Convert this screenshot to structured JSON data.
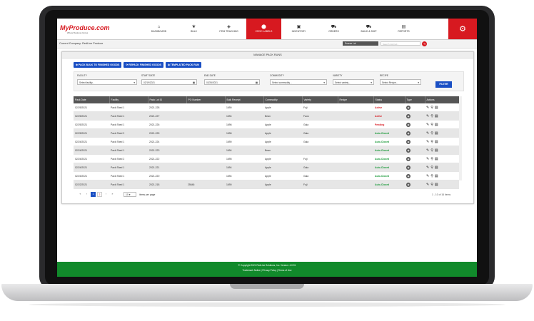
{
  "app": {
    "logo": "MyProduce.com",
    "logo_tagline": "Where Business Grows"
  },
  "nav": [
    {
      "label": "DASHBOARD",
      "icon": "home-icon",
      "glyph": "⌂"
    },
    {
      "label": "BULK",
      "icon": "leaf-icon",
      "glyph": "❦"
    },
    {
      "label": "ITEM TRACKING",
      "icon": "tag-icon",
      "glyph": "◈"
    },
    {
      "label": "CROC LABELS",
      "icon": "label-icon",
      "glyph": "⬤",
      "active": true
    },
    {
      "label": "INVENTORY",
      "icon": "box-icon",
      "glyph": "▣"
    },
    {
      "label": "ORDERS",
      "icon": "cart-icon",
      "glyph": "⛟"
    },
    {
      "label": "BUILD & SHIP",
      "icon": "truck-icon",
      "glyph": "⛟"
    },
    {
      "label": "REPORTS",
      "icon": "chart-icon",
      "glyph": "▤"
    }
  ],
  "companybar": {
    "company": "Current Company: RedLine Produce",
    "source_lot": "Source Lot",
    "search_placeholder": "Search lot/prod..."
  },
  "panel": {
    "title": "MANAGE PACK RUNS",
    "buttons": [
      "PACK BULK TO FINISHED GOODS",
      "REPACK FINISHED GOODS",
      "TEMPLATED PACK RUN"
    ]
  },
  "filters": {
    "facility_label": "FACILITY",
    "facility_value": "Select facility...",
    "start_label": "START DATE",
    "start_value": "02/19/2021",
    "end_label": "END DATE",
    "end_value": "02/26/2021",
    "commodity_label": "COMMODITY",
    "commodity_value": "Select commodity...",
    "variety_label": "VARIETY",
    "variety_value": "Select variety...",
    "recipe_label": "RECIPE",
    "recipe_value": "Select Recipe...",
    "filter_button": "FILTER"
  },
  "table": {
    "columns": [
      "Pack Date",
      "Facility",
      "Pack Lot ID",
      "PO Number",
      "Bulk Receipt",
      "Commodity",
      "Variety",
      "Recipe",
      "Status",
      "Type",
      "Actions"
    ],
    "rows": [
      {
        "date": "02/25/2021",
        "facility": "Pack Shed 1",
        "lot": "2021-228",
        "po": "",
        "receipt": "1690",
        "commodity": "Apple",
        "variety": "Fuji",
        "recipe": "",
        "status": "Active",
        "status_class": "st-active"
      },
      {
        "date": "02/25/2021",
        "facility": "Pack Shed 1",
        "lot": "2021-227",
        "po": "",
        "receipt": "1694",
        "commodity": "Bean",
        "variety": "Fava",
        "recipe": "",
        "status": "Active",
        "status_class": "st-active"
      },
      {
        "date": "02/25/2021",
        "facility": "Pack Shed 1",
        "lot": "2021-226",
        "po": "",
        "receipt": "1696",
        "commodity": "Apple",
        "variety": "Gala",
        "recipe": "",
        "status": "Pending",
        "status_class": "st-pending"
      },
      {
        "date": "02/25/2021",
        "facility": "Pack Shed 2",
        "lot": "2021-225",
        "po": "",
        "receipt": "1696",
        "commodity": "Apple",
        "variety": "Gala",
        "recipe": "",
        "status": "Auto-Closed",
        "status_class": "st-auto"
      },
      {
        "date": "02/24/2021",
        "facility": "Pack Shed 1",
        "lot": "2021-224",
        "po": "",
        "receipt": "1690",
        "commodity": "Apple",
        "variety": "Gala",
        "recipe": "",
        "status": "Auto-Closed",
        "status_class": "st-auto"
      },
      {
        "date": "02/24/2021",
        "facility": "Pack Shed 1",
        "lot": "2021-223",
        "po": "",
        "receipt": "1694",
        "commodity": "Bean",
        "variety": "",
        "recipe": "",
        "status": "Auto-Closed",
        "status_class": "st-auto"
      },
      {
        "date": "02/24/2021",
        "facility": "Pack Shed 2",
        "lot": "2021-222",
        "po": "",
        "receipt": "1695",
        "commodity": "Apple",
        "variety": "Fuji",
        "recipe": "",
        "status": "Auto-Closed",
        "status_class": "st-auto"
      },
      {
        "date": "02/24/2021",
        "facility": "Pack Shed 1",
        "lot": "2021-221",
        "po": "",
        "receipt": "1694",
        "commodity": "Apple",
        "variety": "Gala",
        "recipe": "",
        "status": "Auto-Closed",
        "status_class": "st-auto"
      },
      {
        "date": "02/24/2021",
        "facility": "Pack Shed 1",
        "lot": "2021-220",
        "po": "",
        "receipt": "1694",
        "commodity": "Apple",
        "variety": "Gala",
        "recipe": "",
        "status": "Auto-Closed",
        "status_class": "st-auto"
      },
      {
        "date": "02/22/2021",
        "facility": "Pack Shed 1",
        "lot": "2021-218",
        "po": "25646",
        "receipt": "1690",
        "commodity": "Apple",
        "variety": "Fuji",
        "recipe": "",
        "status": "Auto-Closed",
        "status_class": "st-auto"
      }
    ]
  },
  "pager": {
    "first": "«",
    "prev": "‹",
    "page1": "1",
    "page2": "2",
    "next": "›",
    "last": "»",
    "per_page": "10",
    "per_page_label": "items per page",
    "count": "1 - 10 of 16 items"
  },
  "footer": {
    "copyright": "© Copyright 2021 RedLine Solutions, Inc. Version: 4.0.91",
    "links": "Trademark Notice | Privacy Policy | Terms of Use"
  },
  "colors": {
    "brand_red": "#d71920",
    "action_blue": "#1a4fc4",
    "footer_green": "#118a2b"
  }
}
